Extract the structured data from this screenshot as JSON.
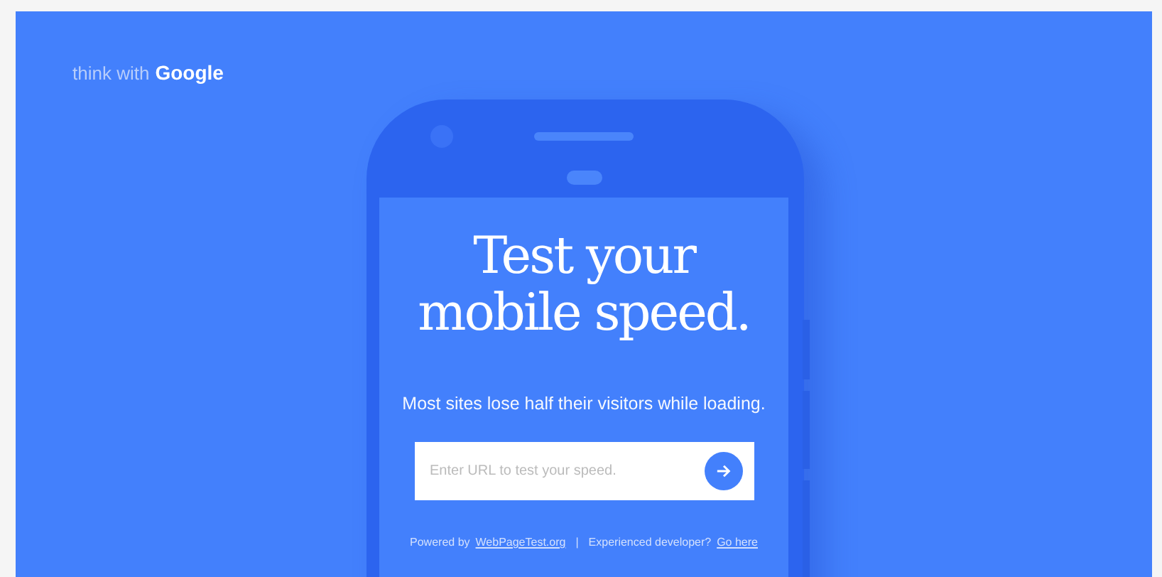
{
  "brand": {
    "prefix": "think with",
    "name": "Google"
  },
  "headline": "Test your mobile speed.",
  "subtitle": "Most sites lose half their visitors while loading.",
  "url_field": {
    "placeholder": "Enter URL to test your speed."
  },
  "footer": {
    "powered_text": "Powered by",
    "powered_link": "WebPageTest.org",
    "separator": "|",
    "developer_text": "Experienced developer?",
    "developer_link": "Go here"
  }
}
